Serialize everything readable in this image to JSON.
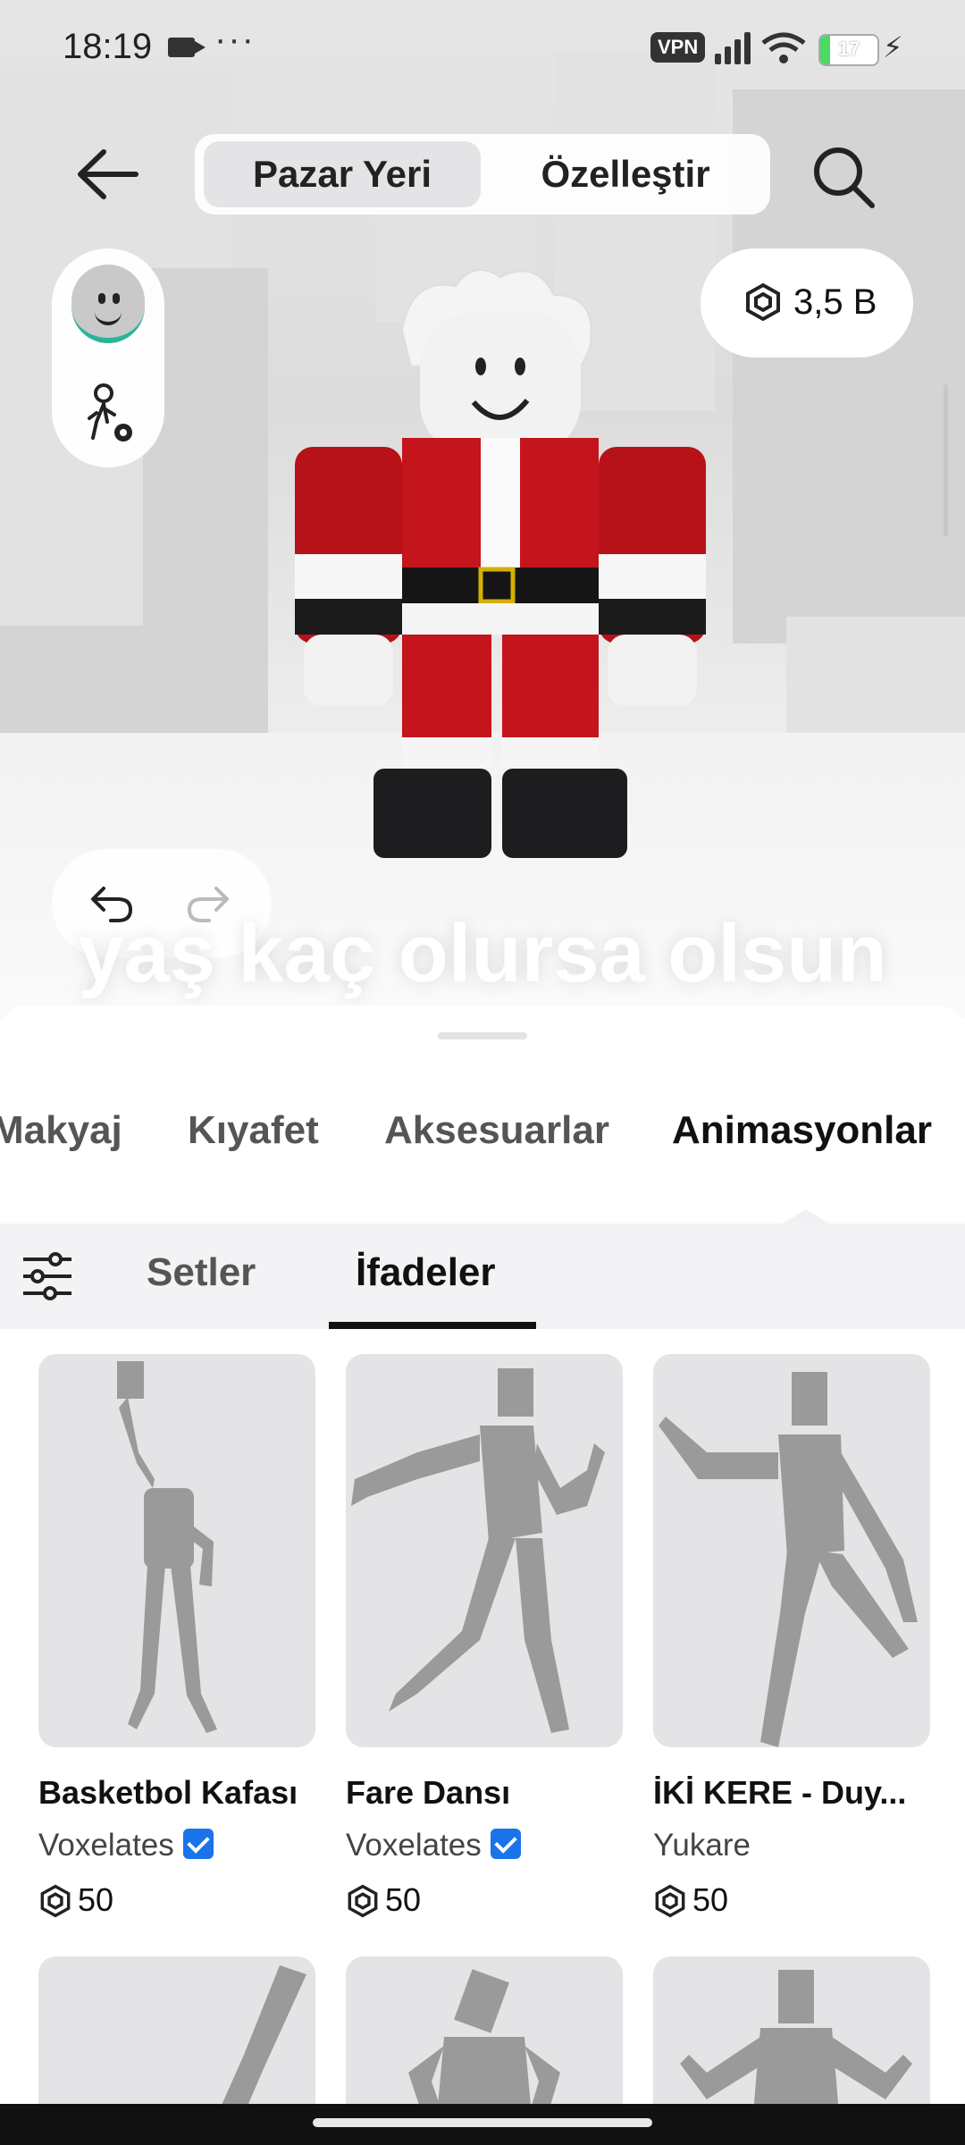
{
  "status_bar": {
    "time": "18:19",
    "dots": "···",
    "vpn": "VPN",
    "battery": "17",
    "battery_level_percent": 17
  },
  "header": {
    "tabs": [
      {
        "label": "Pazar Yeri",
        "active": true
      },
      {
        "label": "Özelleştir",
        "active": false
      }
    ],
    "robux_balance": "3,5 B"
  },
  "overlay_caption": "yaş kaç olursa olsun",
  "categories": [
    {
      "label": "Makyaj",
      "active": false
    },
    {
      "label": "Kıyafet",
      "active": false
    },
    {
      "label": "Aksesuarlar",
      "active": false
    },
    {
      "label": "Animasyonlar",
      "active": true
    }
  ],
  "subtabs": [
    {
      "label": "Setler",
      "active": false
    },
    {
      "label": "İfadeler",
      "active": true
    }
  ],
  "items": [
    {
      "title": "Basketbol Kafası",
      "creator": "Voxelates",
      "verified": true,
      "price": "50"
    },
    {
      "title": "Fare Dansı",
      "creator": "Voxelates",
      "verified": true,
      "price": "50"
    },
    {
      "title": "İKİ KERE - Duy...",
      "creator": "Yukare",
      "verified": false,
      "price": "50"
    }
  ],
  "colors": {
    "accent_verified": "#1a73e8",
    "avatar_suit": "#c4141c",
    "thumb_bg": "#e4e4e6",
    "silhouette": "#9a9a9a"
  },
  "icons": [
    "back-arrow-icon",
    "search-icon",
    "person-gear-icon",
    "robux-icon",
    "undo-icon",
    "redo-icon",
    "filter-icon",
    "verified-icon"
  ]
}
